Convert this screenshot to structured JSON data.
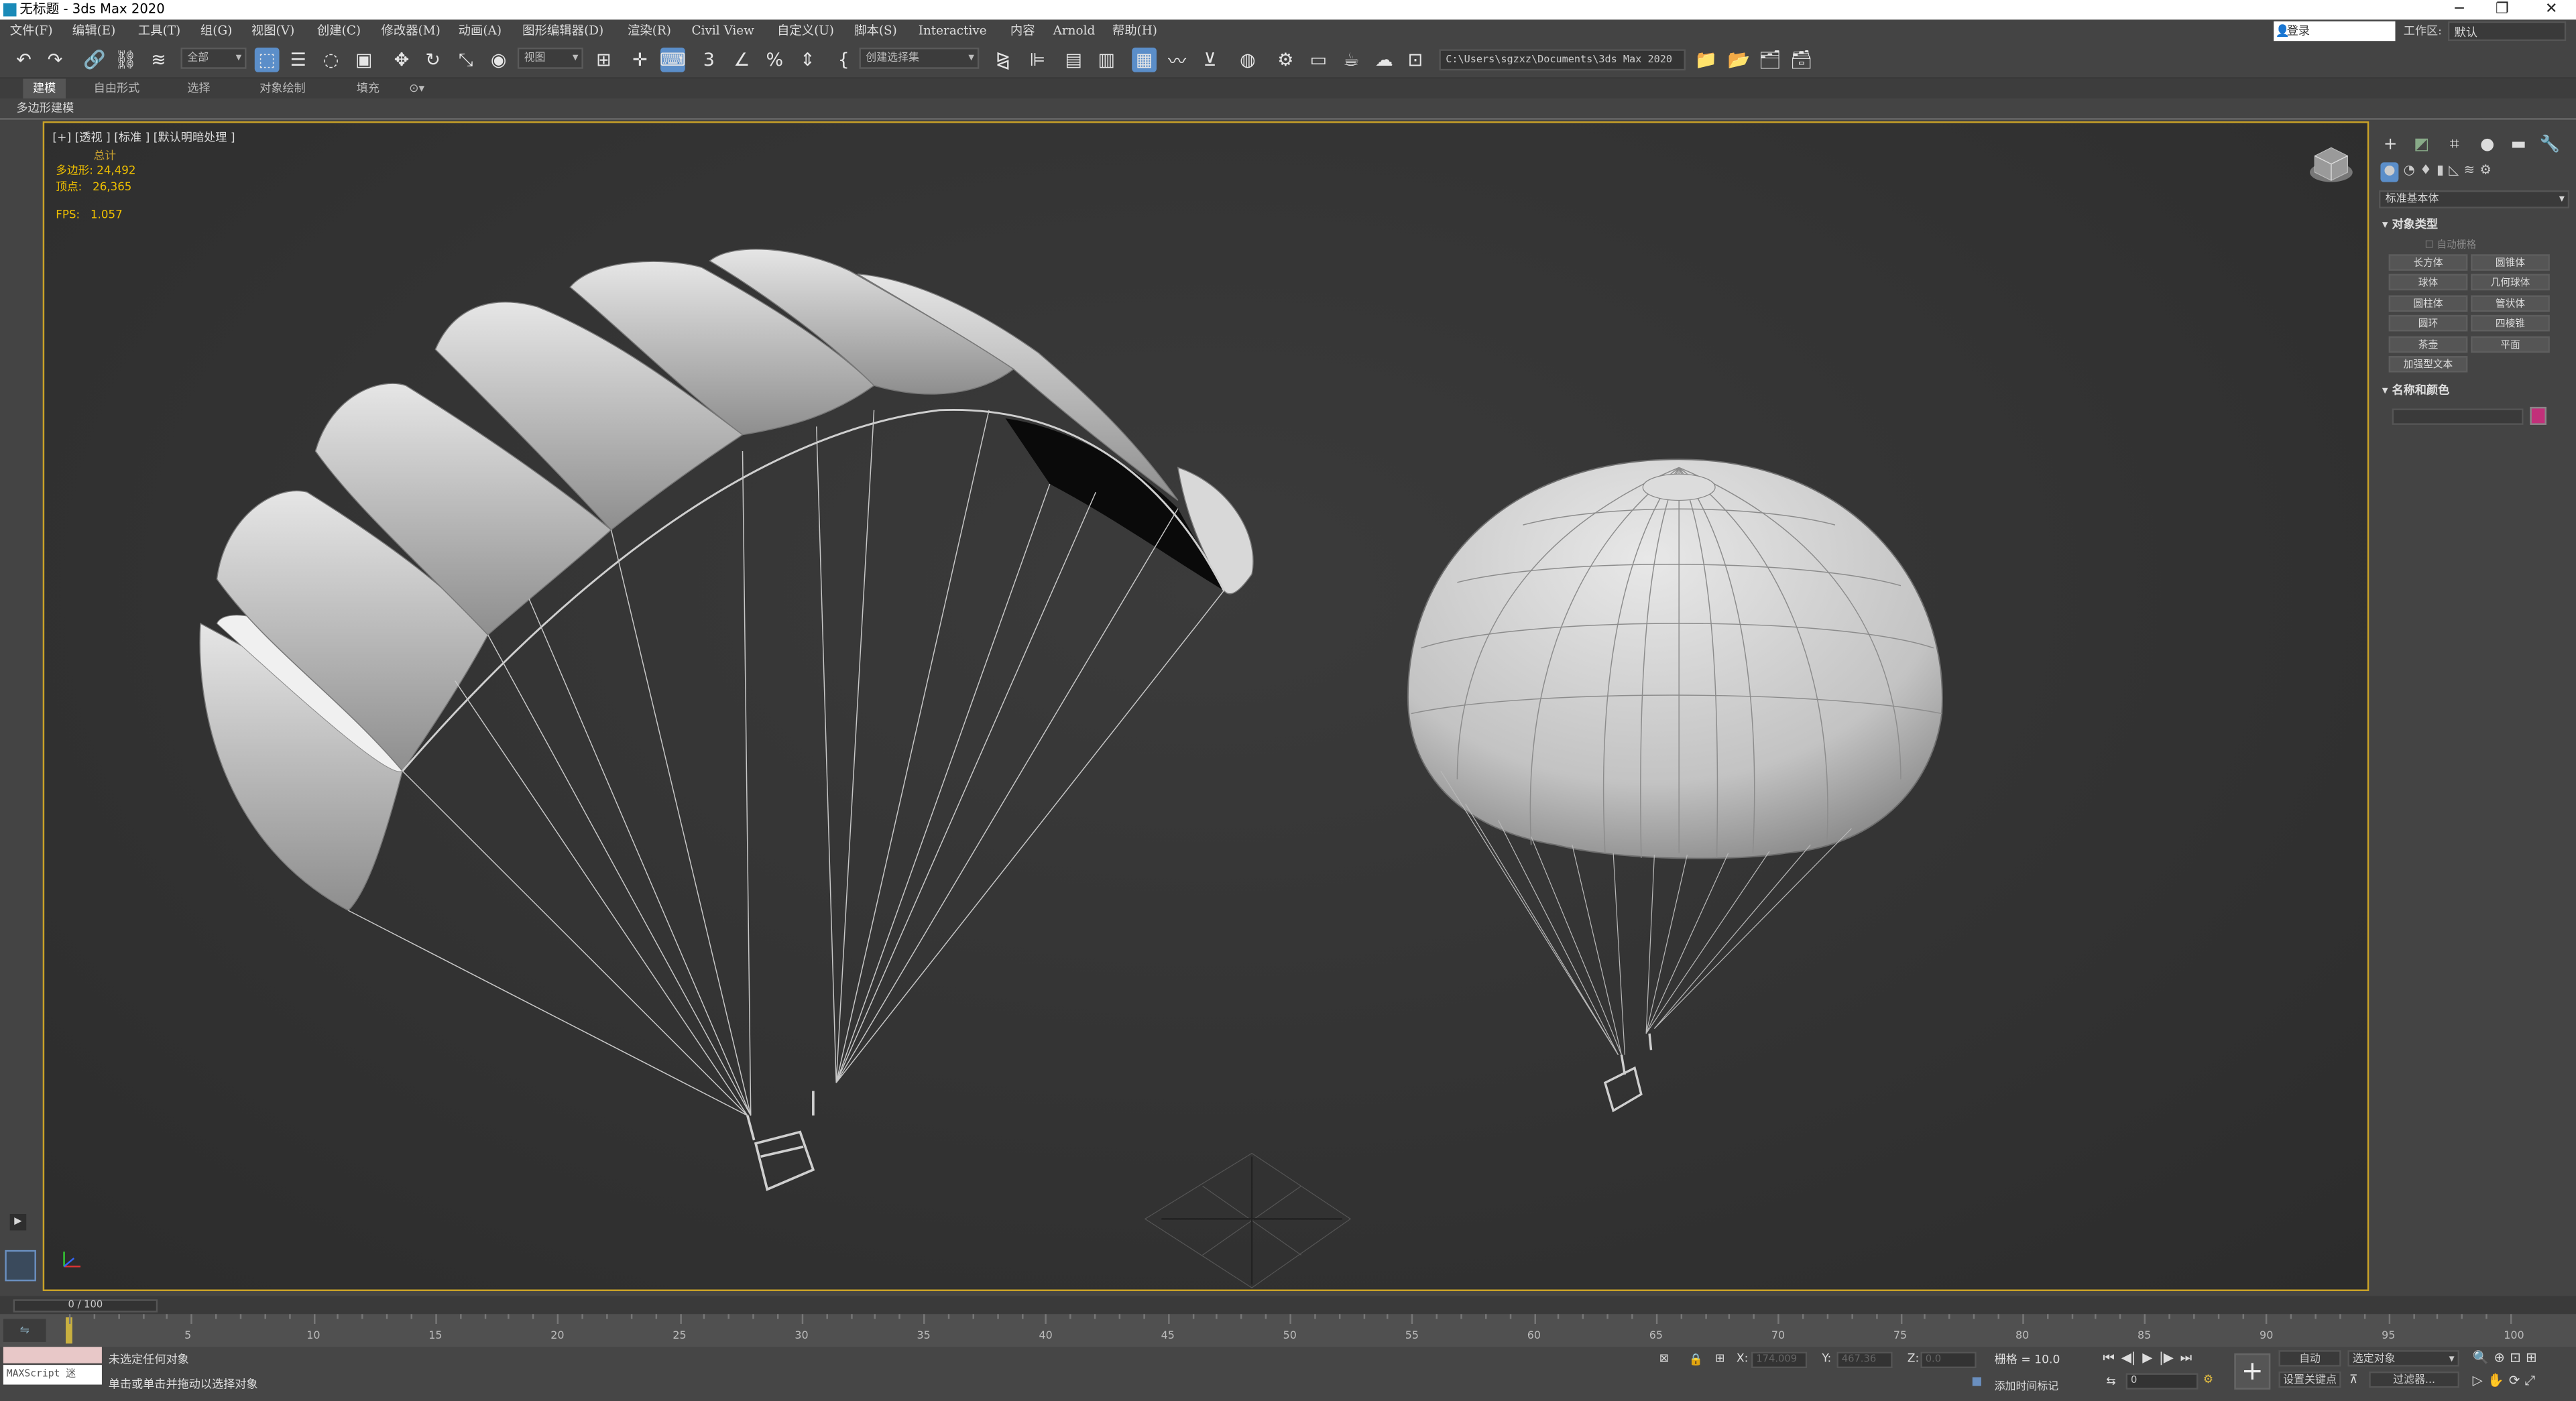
{
  "window": {
    "title": "无标题 - 3ds Max 2020"
  },
  "menu": [
    "文件(F)",
    "编辑(E)",
    "工具(T)",
    "组(G)",
    "视图(V)",
    "创建(C)",
    "修改器(M)",
    "动画(A)",
    "图形编辑器(D)",
    "渲染(R)",
    "Civil View",
    "自定义(U)",
    "脚本(S)",
    "Interactive",
    "内容",
    "Arnold",
    "帮助(H)"
  ],
  "account": {
    "login": "登录",
    "workspace_label": "工作区:",
    "workspace_value": "默认"
  },
  "toolbar": {
    "selection_filter": "全部",
    "ref_coord": "视图",
    "named_selection": "创建选择集",
    "project_path": "C:\\Users\\sgzxz\\Documents\\3ds Max 2020"
  },
  "ribbon": {
    "tabs": [
      "建模",
      "自由形式",
      "选择",
      "对象绘制",
      "填充"
    ],
    "active_panel": "多边形建模"
  },
  "viewport": {
    "label": "[+] [透视 ] [标准 ] [默认明暗处理 ]",
    "stats_header": "总计",
    "polys_label": "多边形:",
    "polys_value": "24,492",
    "verts_label": "顶点:",
    "verts_value": "26,365",
    "fps_label": "FPS:",
    "fps_value": "1.057"
  },
  "command_panel": {
    "category_dropdown": "标准基本体",
    "object_type_header": "对象类型",
    "autogrid": "自动栅格",
    "buttons": [
      "长方体",
      "圆锥体",
      "球体",
      "几何球体",
      "圆柱体",
      "管状体",
      "圆环",
      "四棱锥",
      "茶壶",
      "平面",
      "加强型文本"
    ],
    "name_color_header": "名称和颜色",
    "object_color": "#c2307a"
  },
  "timeline": {
    "frame_display": "0 / 100",
    "ticks": [
      "0",
      "5",
      "10",
      "15",
      "20",
      "25",
      "30",
      "35",
      "40",
      "45",
      "50",
      "55",
      "60",
      "65",
      "70",
      "75",
      "80",
      "85",
      "90",
      "95",
      "100"
    ]
  },
  "status": {
    "maxscript": "MAXScript 迷",
    "line1": "未选定任何对象",
    "line2": "单击或单击并拖动以选择对象",
    "x_label": "X:",
    "x_value": "174.009",
    "y_label": "Y:",
    "y_value": "467.36",
    "z_label": "Z:",
    "z_value": "0.0",
    "grid": "栅格 = 10.0",
    "add_time_tag": "添加时间标记",
    "auto_key": "自动",
    "selected_object": "选定对象",
    "set_key": "设置关键点",
    "filters": "过滤器...",
    "frame_value": "0"
  }
}
